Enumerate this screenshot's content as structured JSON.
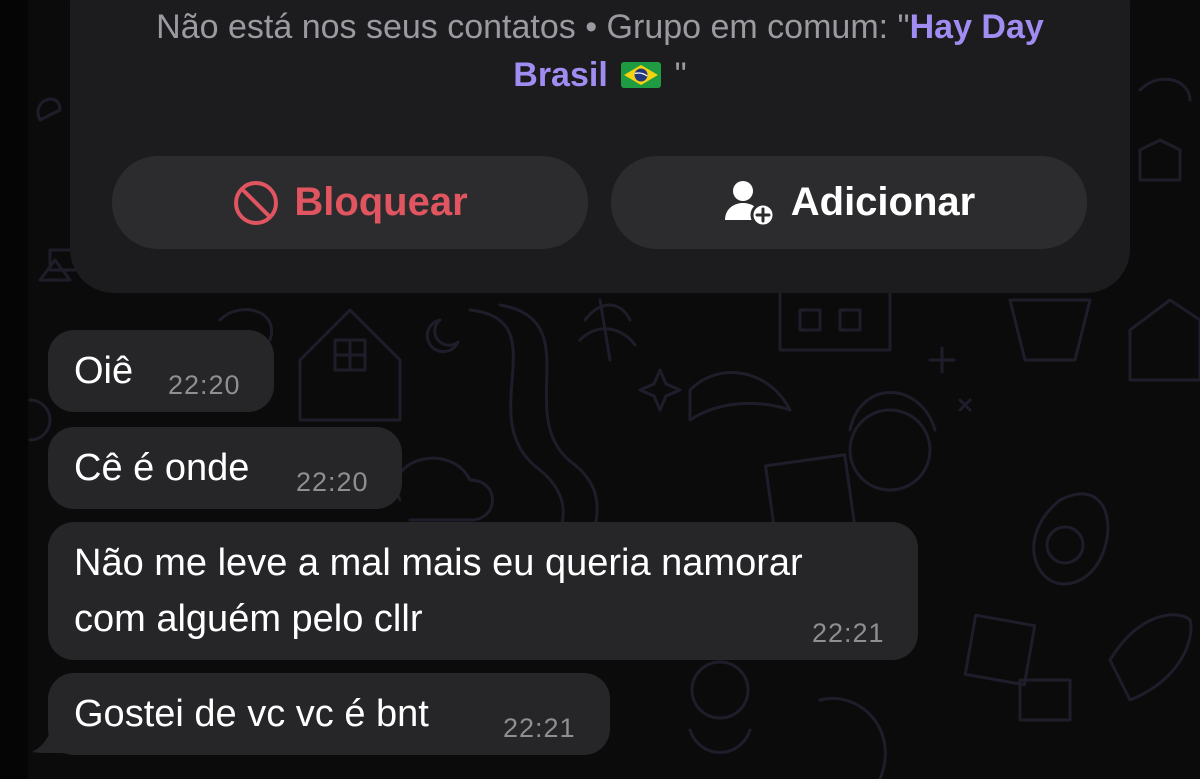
{
  "contact_info": {
    "line1": "Não está nos seus contatos • Grupo em comum: \"",
    "group_name_part1": "Hay Day",
    "group_name_part2": "Brasil",
    "flag_icon": "brazil-flag-icon",
    "closing_quote": " \""
  },
  "actions": {
    "block_label": "Bloquear",
    "block_icon": "prohibited-icon",
    "add_label": "Adicionar",
    "add_icon": "add-contact-icon"
  },
  "messages": [
    {
      "text": "Oiê",
      "time": "22:20"
    },
    {
      "text": "Cê é onde",
      "time": "22:20"
    },
    {
      "text_line1": "Não me leve a mal mais eu queria namorar",
      "text_line2": "com alguém pelo cllr",
      "time": "22:21"
    },
    {
      "text": "Gostei de vc vc é bnt",
      "time": "22:21"
    }
  ],
  "colors": {
    "background": "#0b0b0c",
    "card": "#1c1c1e",
    "button": "#2c2c2e",
    "bubble": "#262628",
    "accent_purple": "#a18cf2",
    "block_red": "#e0555f"
  }
}
